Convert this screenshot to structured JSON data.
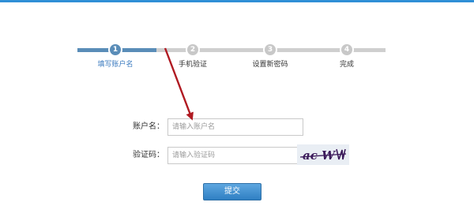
{
  "steps": [
    {
      "number": "1",
      "label": "填写账户名",
      "state": "active"
    },
    {
      "number": "2",
      "label": "手机验证",
      "state": "inactive"
    },
    {
      "number": "3",
      "label": "设置新密码",
      "state": "inactive"
    },
    {
      "number": "4",
      "label": "完成",
      "state": "inactive"
    }
  ],
  "form": {
    "account": {
      "label": "账户名：",
      "placeholder": "请输入账户名",
      "value": ""
    },
    "captcha": {
      "label": "验证码：",
      "placeholder": "请输入验证码",
      "value": "",
      "image_text": "ac W"
    }
  },
  "submit_label": "提交",
  "colors": {
    "accent": "#2f8fd6",
    "step_active": "#5a8db8",
    "step_inactive": "#c8c8c8",
    "arrow": "#b01a22"
  }
}
